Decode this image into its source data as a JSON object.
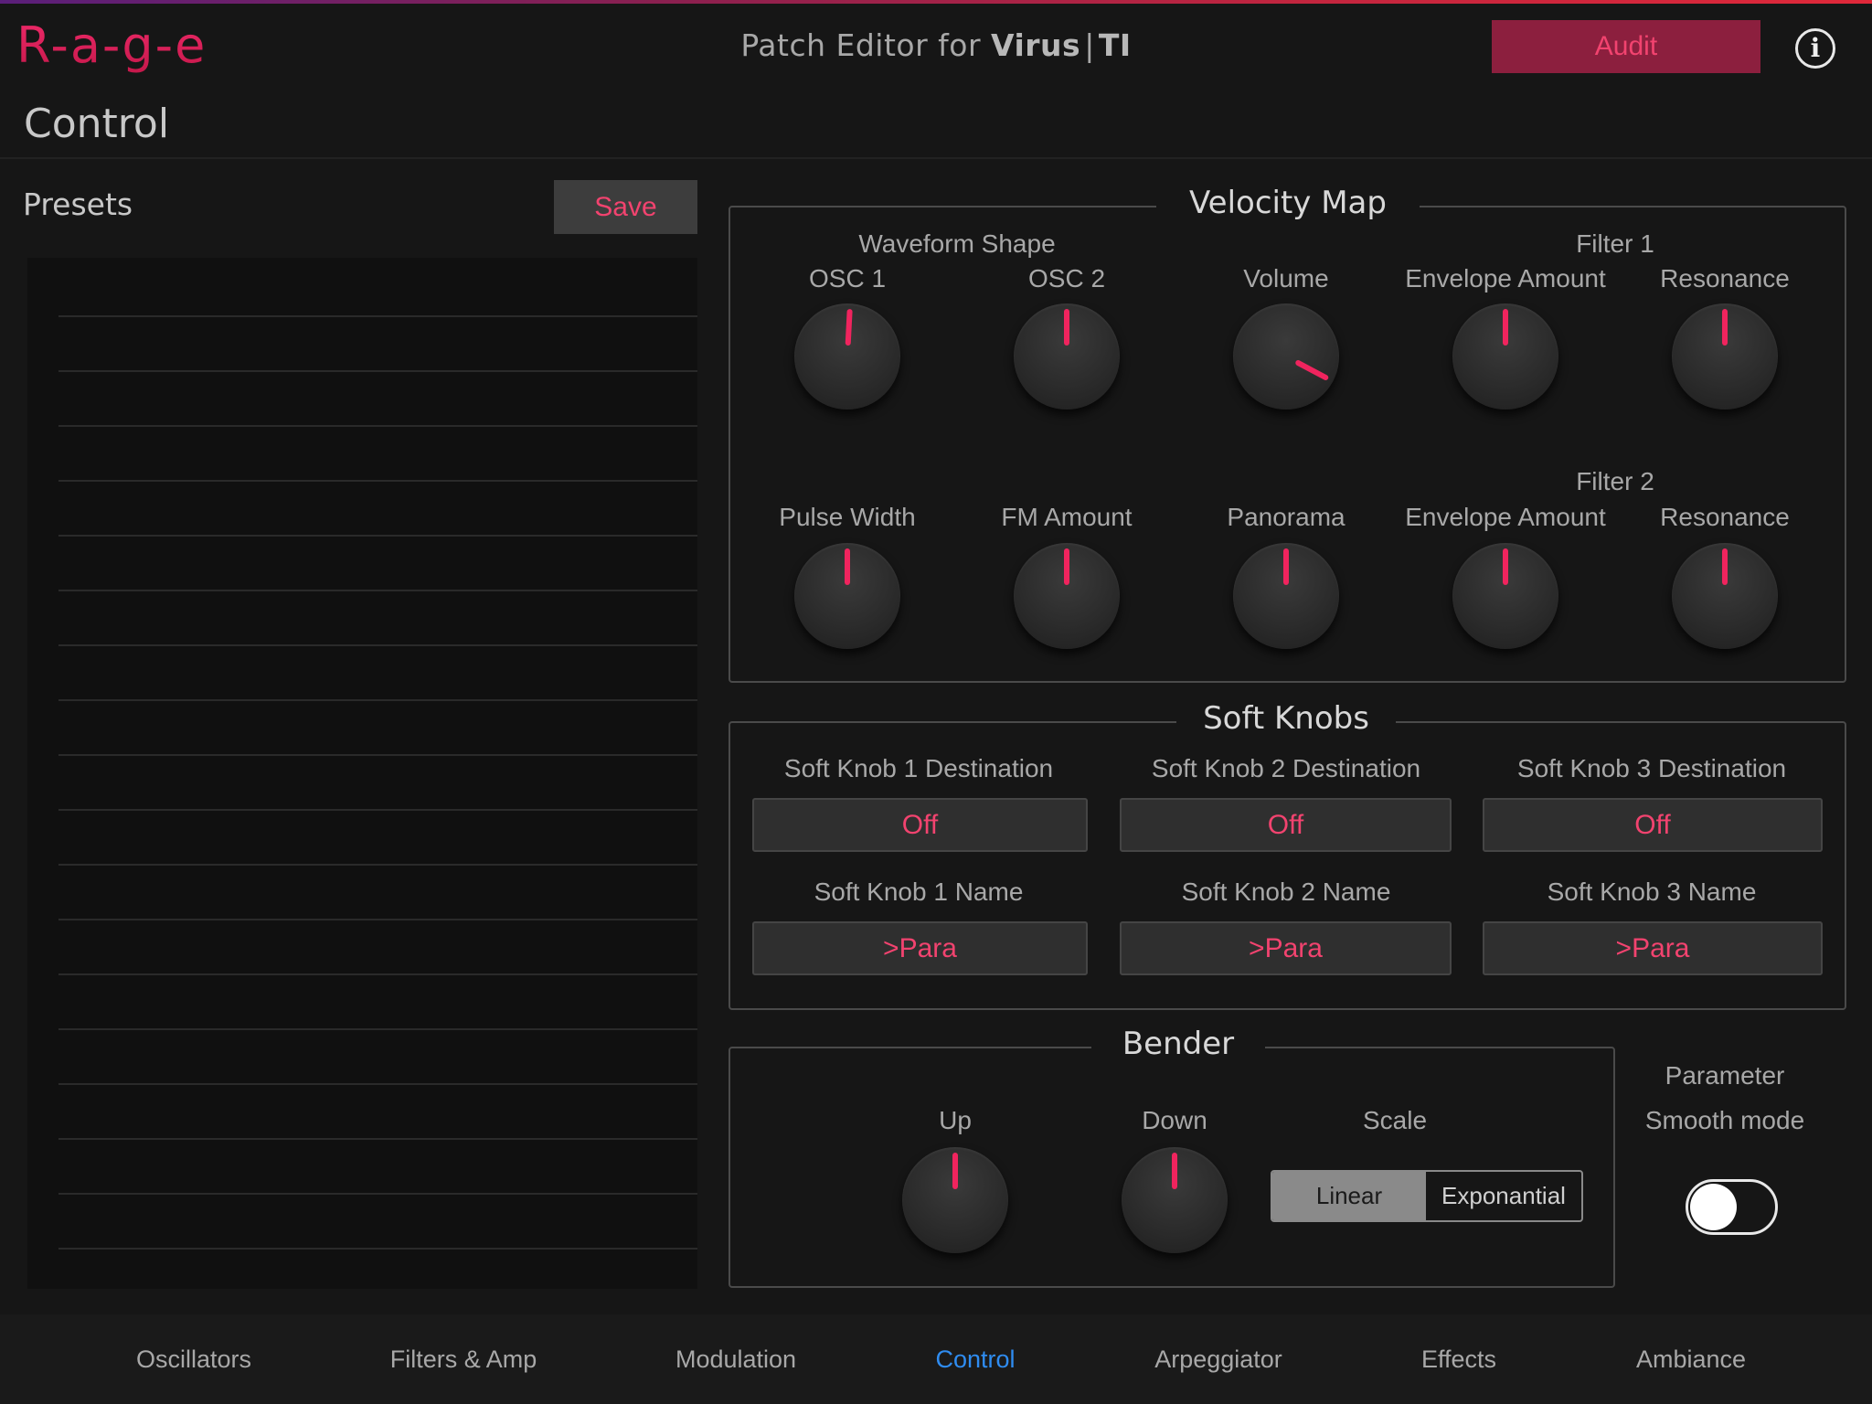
{
  "app": {
    "logo": "R-a-g-e",
    "title_prefix": "Patch Editor for ",
    "title_brand": "Virus",
    "title_sep": "|",
    "title_model": "TI",
    "audit_label": "Audit",
    "info_icon": "i"
  },
  "page": {
    "title": "Control"
  },
  "presets": {
    "label": "Presets",
    "save_label": "Save"
  },
  "velocity_map": {
    "title": "Velocity Map",
    "waveform_shape_label": "Waveform Shape",
    "filter1_label": "Filter 1",
    "filter2_label": "Filter 2",
    "knobs_row1": [
      {
        "label": "OSC 1",
        "angle_deg": 3
      },
      {
        "label": "OSC 2",
        "angle_deg": 0
      },
      {
        "label": "Volume",
        "angle_deg": 118
      },
      {
        "label": "Envelope Amount",
        "angle_deg": 0
      },
      {
        "label": "Resonance",
        "angle_deg": 0
      }
    ],
    "knobs_row2": [
      {
        "label": "Pulse Width",
        "angle_deg": 0
      },
      {
        "label": "FM Amount",
        "angle_deg": 0
      },
      {
        "label": "Panorama",
        "angle_deg": 0
      },
      {
        "label": "Envelope Amount",
        "angle_deg": 0
      },
      {
        "label": "Resonance",
        "angle_deg": 0
      }
    ]
  },
  "soft_knobs": {
    "title": "Soft Knobs",
    "destinations": [
      {
        "label": "Soft Knob 1 Destination",
        "value": "Off"
      },
      {
        "label": "Soft Knob 2 Destination",
        "value": "Off"
      },
      {
        "label": "Soft Knob 3 Destination",
        "value": "Off"
      }
    ],
    "names": [
      {
        "label": "Soft Knob 1 Name",
        "value": ">Para"
      },
      {
        "label": "Soft Knob 2 Name",
        "value": ">Para"
      },
      {
        "label": "Soft Knob 3 Name",
        "value": ">Para"
      }
    ]
  },
  "bender": {
    "title": "Bender",
    "up_label": "Up",
    "up_angle_deg": 0,
    "down_label": "Down",
    "down_angle_deg": 0,
    "scale_label": "Scale",
    "scale_options": [
      "Linear",
      "Exponantial"
    ],
    "scale_selected": "Linear"
  },
  "smooth_mode": {
    "label_line1": "Parameter",
    "label_line2": "Smooth mode",
    "enabled": false
  },
  "bottom_nav": {
    "items": [
      "Oscillators",
      "Filters & Amp",
      "Modulation",
      "Control",
      "Arpeggiator",
      "Effects",
      "Ambiance"
    ],
    "active": "Control"
  },
  "colors": {
    "accent": "#f2436f",
    "audit_bg": "#8c1f3e",
    "nav_active": "#2f8cf0",
    "knob_indicator": "#f0245e"
  }
}
